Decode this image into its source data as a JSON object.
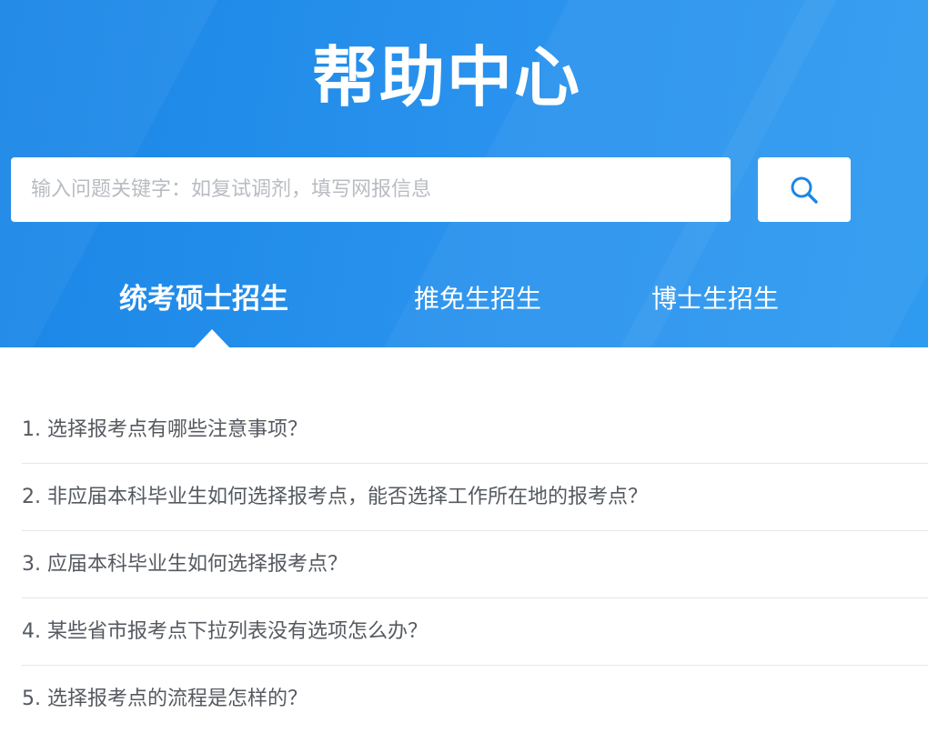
{
  "header": {
    "title": "帮助中心",
    "background": "#1b86e6"
  },
  "search": {
    "placeholder": "输入问题关键字：如复试调剂，填写网报信息",
    "value": "",
    "button_icon": "search-icon",
    "icon_color": "#1b86e6"
  },
  "tabs": [
    {
      "label": "统考硕士招生",
      "active": true
    },
    {
      "label": "推免生招生",
      "active": false
    },
    {
      "label": "博士生招生",
      "active": false
    }
  ],
  "faq": [
    {
      "text": "1. 选择报考点有哪些注意事项？"
    },
    {
      "text": "2. 非应届本科毕业生如何选择报考点，能否选择工作所在地的报考点？"
    },
    {
      "text": "3. 应届本科毕业生如何选择报考点？"
    },
    {
      "text": "4. 某些省市报考点下拉列表没有选项怎么办？"
    },
    {
      "text": "5. 选择报考点的流程是怎样的？"
    }
  ]
}
